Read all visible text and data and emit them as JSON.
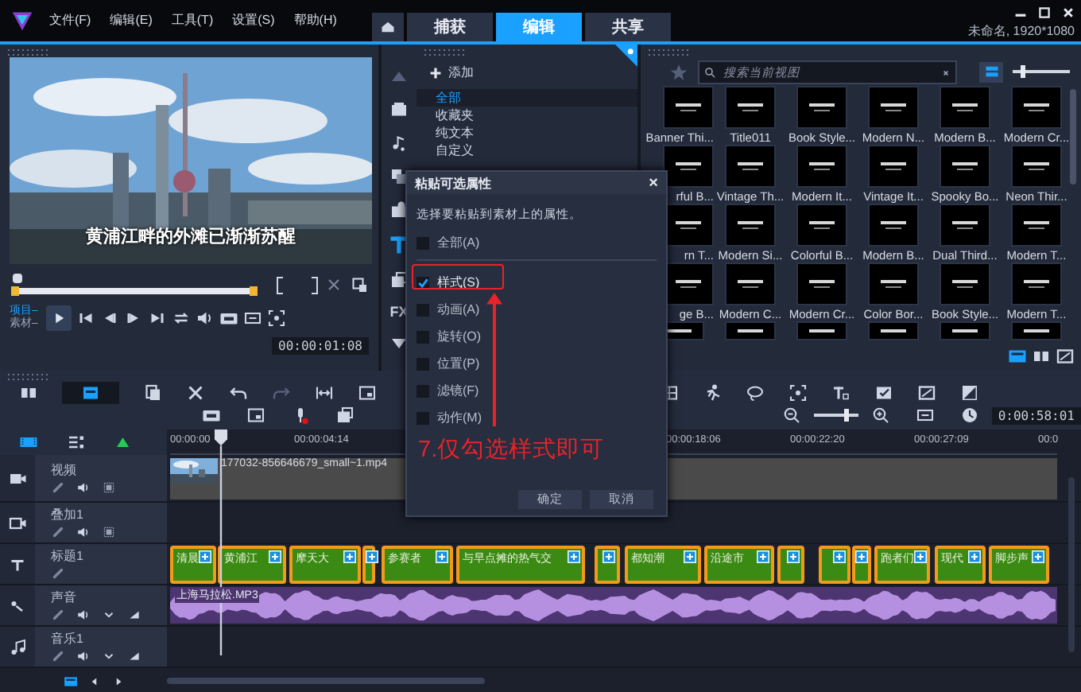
{
  "menu": [
    "文件(F)",
    "编辑(E)",
    "工具(T)",
    "设置(S)",
    "帮助(H)"
  ],
  "tabs": [
    {
      "label": "捕获",
      "selected": false
    },
    {
      "label": "编辑",
      "selected": true
    },
    {
      "label": "共享",
      "selected": false
    }
  ],
  "project_info": "未命名, 1920*1080",
  "player": {
    "caption": "黄浦江畔的外滩已渐渐苏醒",
    "modes": [
      {
        "label": "项目–",
        "selected": true
      },
      {
        "label": "素材–",
        "selected": false
      }
    ],
    "timecode": "00:00:01:08"
  },
  "library": {
    "add": "添加",
    "fx_tab": "FX",
    "categories": [
      {
        "label": "全部",
        "selected": true
      },
      {
        "label": "收藏夹",
        "selected": false
      },
      {
        "label": "纯文本",
        "selected": false
      },
      {
        "label": "自定义",
        "selected": false
      }
    ],
    "search_placeholder": "搜索当前视图",
    "size_slider": {
      "level": 0.15
    },
    "thumbnail_rows": [
      [
        "Banner Thi...",
        "Title011",
        "Book Style...",
        "Modern N...",
        "Modern B...",
        "Modern Cr..."
      ],
      [
        "rful B...",
        "Vintage Th...",
        "Modern It...",
        "Vintage It...",
        "Spooky Bo...",
        "Neon Thir..."
      ],
      [
        "rn T...",
        "Modern Si...",
        "Colorful B...",
        "Modern B...",
        "Dual Third...",
        "Modern T..."
      ],
      [
        "ge B...",
        "Modern C...",
        "Modern Cr...",
        "Color Bor...",
        "Book Style...",
        "Modern T..."
      ]
    ]
  },
  "dialog": {
    "title": "粘贴可选属性",
    "close": "×",
    "description": "选择要粘贴到素材上的属性。",
    "options": [
      {
        "label": "全部(A)",
        "checked": false
      },
      {
        "label": "样式(S)",
        "checked": true
      },
      {
        "label": "动画(A)",
        "checked": false
      },
      {
        "label": "旋转(O)",
        "checked": false
      },
      {
        "label": "位置(P)",
        "checked": false
      },
      {
        "label": "滤镜(F)",
        "checked": false
      },
      {
        "label": "动作(M)",
        "checked": false
      }
    ],
    "buttons": [
      "确定",
      "取消"
    ]
  },
  "annotation": "7.仅勾选样式即可",
  "timeline": {
    "timecode": "0:00:58:01",
    "ruler": [
      "00:00:00",
      "00:00:04:14",
      "00:00:18:06",
      "00:00:22:20",
      "00:00:27:09",
      "00:0"
    ],
    "tracks": [
      {
        "name": "视频",
        "kind": "video"
      },
      {
        "name": "叠加1",
        "kind": "overlay"
      },
      {
        "name": "标题1",
        "kind": "title"
      },
      {
        "name": "声音",
        "kind": "voice"
      },
      {
        "name": "音乐1",
        "kind": "music"
      }
    ],
    "video_clip": "177032-856646679_small~1.mp4",
    "audio_clip": "上海马拉松.MP3",
    "zoom_slider": {
      "level": 0.7
    },
    "title_clips": [
      {
        "kind": "text",
        "text": "清晨"
      },
      {
        "kind": "text",
        "text": "黄浦江"
      },
      {
        "kind": "text",
        "text": "摩天大"
      },
      {
        "kind": "blank"
      },
      {
        "kind": "text",
        "text": "参赛者"
      },
      {
        "kind": "text",
        "text": "与早点摊的热气交"
      },
      {
        "kind": "blank"
      },
      {
        "kind": "text",
        "text": "都知潮"
      },
      {
        "kind": "text",
        "text": "沿途市"
      },
      {
        "kind": "blank"
      },
      {
        "kind": "blank"
      },
      {
        "kind": "blank"
      },
      {
        "kind": "text",
        "text": "跑者们"
      },
      {
        "kind": "text",
        "text": "现代"
      },
      {
        "kind": "text",
        "text": "脚步声"
      }
    ]
  }
}
